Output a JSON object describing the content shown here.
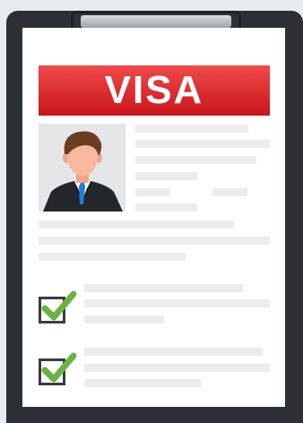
{
  "banner": {
    "text": "VISA"
  },
  "colors": {
    "banner_red": "#d9262b",
    "board": "#2d3136",
    "check_green": "#6ab245",
    "line_gray": "#ececec"
  },
  "icons": {
    "photo": "businessman-avatar-icon",
    "check": "green-checkmark-icon"
  },
  "checklist": [
    {
      "checked": true
    },
    {
      "checked": true
    }
  ]
}
